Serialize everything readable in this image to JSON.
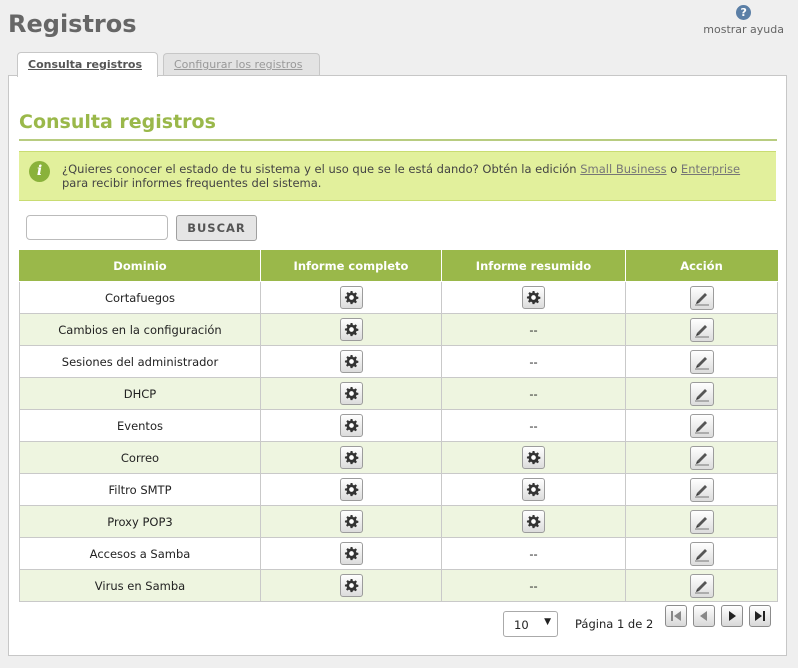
{
  "page": {
    "title": "Registros",
    "help_label": "mostrar ayuda",
    "help_glyph": "?"
  },
  "tabs": [
    {
      "label": "Consulta registros",
      "active": true
    },
    {
      "label": "Configurar los registros",
      "active": false
    }
  ],
  "section": {
    "title": "Consulta registros"
  },
  "note": {
    "icon_glyph": "i",
    "text_before": "¿Quieres conocer el estado de tu sistema y el uso que se le está dando? Obtén la edición ",
    "link1": "Small Business",
    "text_mid": " o ",
    "link2": "Enterprise",
    "text_after": "para recibir informes frequentes del sistema."
  },
  "search": {
    "value": "",
    "placeholder": "",
    "button_label": "BUSCAR"
  },
  "table": {
    "headers": [
      "Dominio",
      "Informe completo",
      "Informe resumido",
      "Acción"
    ],
    "dash": "--",
    "rows": [
      {
        "domain": "Cortafuegos",
        "full": true,
        "summary": true
      },
      {
        "domain": "Cambios en la configuración",
        "full": true,
        "summary": false
      },
      {
        "domain": "Sesiones del administrador",
        "full": true,
        "summary": false
      },
      {
        "domain": "DHCP",
        "full": true,
        "summary": false
      },
      {
        "domain": "Eventos",
        "full": true,
        "summary": false
      },
      {
        "domain": "Correo",
        "full": true,
        "summary": true
      },
      {
        "domain": "Filtro SMTP",
        "full": true,
        "summary": true
      },
      {
        "domain": "Proxy POP3",
        "full": true,
        "summary": true
      },
      {
        "domain": "Accesos a Samba",
        "full": true,
        "summary": false
      },
      {
        "domain": "Virus en Samba",
        "full": true,
        "summary": false
      }
    ]
  },
  "pager": {
    "page_size": "10",
    "info": "Página 1 de 2",
    "icons": [
      "first-page-icon",
      "previous-page-icon",
      "next-page-icon",
      "last-page-icon"
    ]
  },
  "colors": {
    "accent": "#9ab84a",
    "note_bg": "#e2f09c",
    "row_alt": "#eef5e0"
  }
}
